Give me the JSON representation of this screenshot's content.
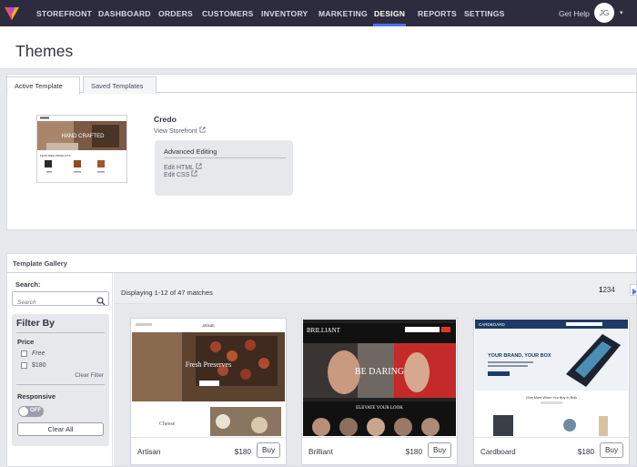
{
  "topnav": {
    "items": [
      "STOREFRONT",
      "DASHBOARD",
      "ORDERS",
      "CUSTOMERS",
      "INVENTORY",
      "MARKETING",
      "DESIGN",
      "REPORTS",
      "SETTINGS"
    ],
    "active": "DESIGN",
    "help_label": "Get Help",
    "avatar_initials": "JG",
    "accent": "#4b71fc",
    "bg": "#2d2c3e"
  },
  "page": {
    "title": "Themes"
  },
  "template_tabs": {
    "active_label": "Active Template",
    "saved_label": "Saved Templates"
  },
  "active_template": {
    "name": "Credo",
    "view_storefront": "View Storefront",
    "advanced_title": "Advanced Editing",
    "edit_html": "Edit HTML",
    "edit_css": "Edit CSS",
    "thumb_headline": "HAND CRAFTED",
    "thumb_section": "FEATURED PRODUCTS"
  },
  "gallery": {
    "title": "Template Gallery",
    "search_label": "Search:",
    "search_placeholder": "Search",
    "filter_title": "Filter By",
    "price_label": "Price",
    "price_options": [
      "Free",
      "$180"
    ],
    "clear_filter": "Clear Filter",
    "responsive_label": "Responsive",
    "toggle_state": "OFF",
    "clear_all": "Clear All",
    "matches_text": "Displaying 1-12 of 47 matches",
    "pages": [
      "1",
      "2",
      "3",
      "4"
    ],
    "current_page": "1",
    "buy_label": "Buy",
    "cards": [
      {
        "name": "Artisan",
        "price": "$180",
        "brand": "artisan",
        "hero_text": "Fresh Preserves",
        "sub_text": "Cheese"
      },
      {
        "name": "Brilliant",
        "price": "$180",
        "brand": "BRILLIANT",
        "hero_text": "BE DARING",
        "sub_text": "ELEVATE YOUR LOOK"
      },
      {
        "name": "Cardboard",
        "price": "$180",
        "brand": "CARDBOARD",
        "hero_text": "YOUR BRAND, YOUR BOX",
        "sub_text": "Give More When You Buy In Bulk"
      }
    ]
  }
}
